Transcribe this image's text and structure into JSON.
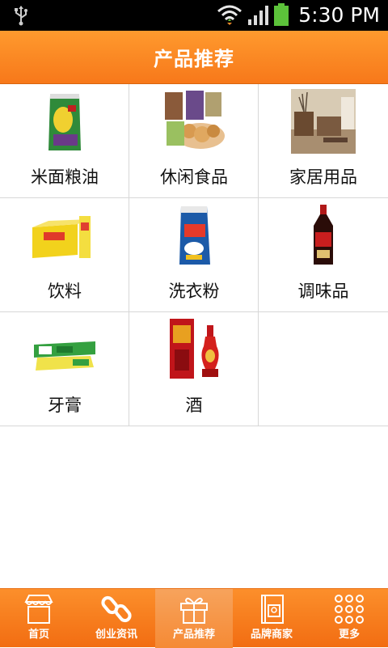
{
  "status_bar": {
    "time": "5:30 PM"
  },
  "title": "产品推荐",
  "categories": [
    {
      "label": "米面粮油",
      "icon": "rice-bag-image"
    },
    {
      "label": "休闲食品",
      "icon": "snack-food-image"
    },
    {
      "label": "家居用品",
      "icon": "home-furniture-image"
    },
    {
      "label": "饮料",
      "icon": "beverage-box-image"
    },
    {
      "label": "洗衣粉",
      "icon": "laundry-powder-image"
    },
    {
      "label": "调味品",
      "icon": "soy-sauce-bottle-image"
    },
    {
      "label": "牙膏",
      "icon": "toothpaste-image"
    },
    {
      "label": "酒",
      "icon": "liquor-bottle-image"
    }
  ],
  "tabs": [
    {
      "label": "首页",
      "icon": "shop-home-icon"
    },
    {
      "label": "创业资讯",
      "icon": "chain-link-icon"
    },
    {
      "label": "产品推荐",
      "icon": "gift-box-icon",
      "active": true
    },
    {
      "label": "品牌商家",
      "icon": "brand-book-icon"
    },
    {
      "label": "更多",
      "icon": "dots-grid-icon"
    }
  ],
  "colors": {
    "accent": "#f7781a",
    "tab_active": "#f58a35"
  }
}
